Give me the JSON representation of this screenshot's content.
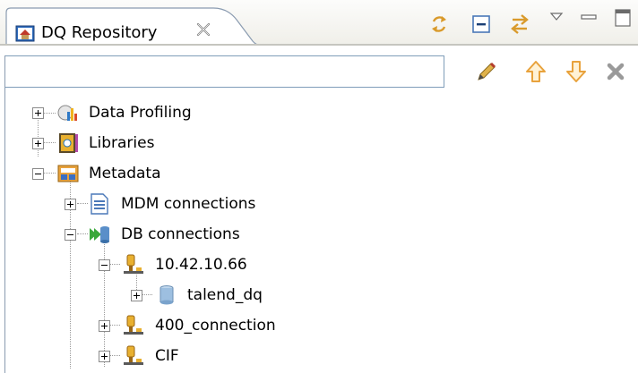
{
  "view": {
    "title": "DQ Repository",
    "filter_value": ""
  },
  "tree": {
    "items": [
      {
        "label": "Data Profiling",
        "icon": "data-profiling-icon",
        "state": "collapsed"
      },
      {
        "label": "Libraries",
        "icon": "libraries-icon",
        "state": "collapsed"
      },
      {
        "label": "Metadata",
        "icon": "metadata-folder-icon",
        "state": "expanded"
      },
      {
        "label": "MDM connections",
        "icon": "document-icon",
        "state": "collapsed"
      },
      {
        "label": "DB connections",
        "icon": "db-connections-icon",
        "state": "expanded"
      },
      {
        "label": "10.42.10.66",
        "icon": "connection-plug-icon",
        "state": "expanded"
      },
      {
        "label": "talend_dq",
        "icon": "database-cylinder-icon",
        "state": "collapsed"
      },
      {
        "label": "400_connection",
        "icon": "connection-plug-icon",
        "state": "collapsed"
      },
      {
        "label": "CIF",
        "icon": "connection-plug-icon",
        "state": "collapsed"
      }
    ]
  },
  "colors": {
    "accent_blue": "#2d6bbd",
    "border": "#8a9bb0",
    "nav_arrow": "#e8a23c"
  }
}
